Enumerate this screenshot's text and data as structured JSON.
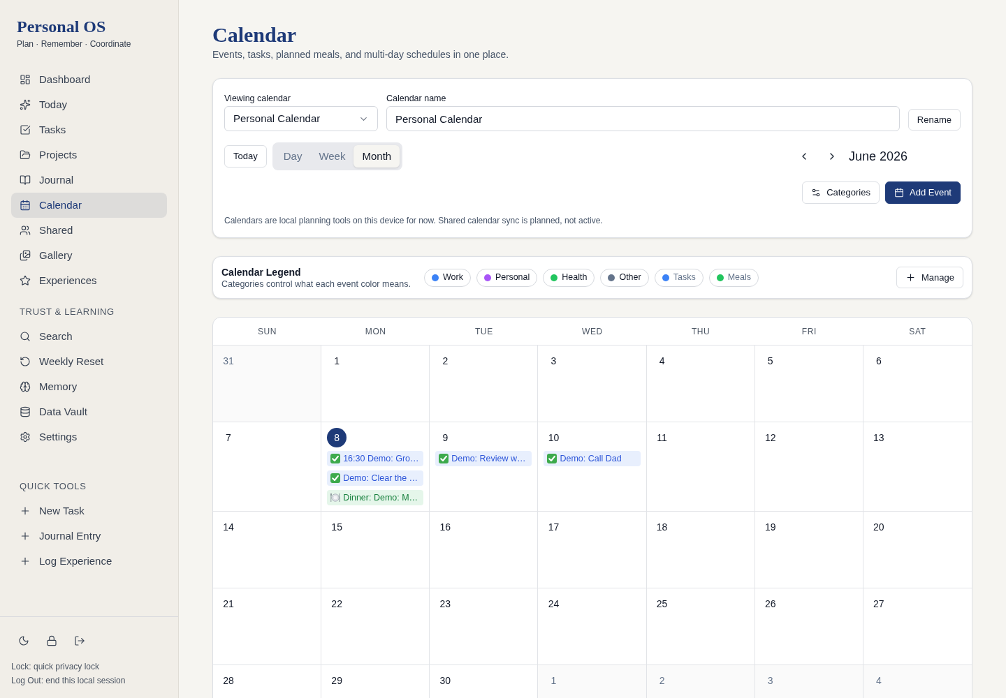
{
  "sidebar": {
    "title": "Personal OS",
    "tagline": "Plan · Remember · Coordinate",
    "nav": [
      {
        "label": "Dashboard",
        "selected": false
      },
      {
        "label": "Today",
        "selected": false
      },
      {
        "label": "Tasks",
        "selected": false
      },
      {
        "label": "Projects",
        "selected": false
      },
      {
        "label": "Journal",
        "selected": false
      },
      {
        "label": "Calendar",
        "selected": true
      },
      {
        "label": "Shared",
        "selected": false
      },
      {
        "label": "Gallery",
        "selected": false
      },
      {
        "label": "Experiences",
        "selected": false
      }
    ],
    "trust_learning": {
      "heading": "TRUST & LEARNING",
      "items": [
        {
          "label": "Search",
          "selected": false
        },
        {
          "label": "Weekly Reset",
          "selected": false
        },
        {
          "label": "Memory",
          "selected": false
        },
        {
          "label": "Data Vault",
          "selected": false
        },
        {
          "label": "Settings",
          "selected": false
        }
      ]
    },
    "quick_tools": {
      "heading": "QUICK TOOLS",
      "items": [
        "New Task",
        "Journal Entry",
        "Log Experience"
      ]
    },
    "footer_notes": [
      "Lock: quick privacy lock",
      "Log Out: end this local session"
    ]
  },
  "header": {
    "title": "Calendar",
    "subtitle": "Events, tasks, planned meals, and multi-day schedules in one place."
  },
  "controls": {
    "viewing_calendar": {
      "label": "Viewing calendar",
      "value": "Personal Calendar"
    },
    "calendar_name": {
      "label": "Calendar name",
      "value": "Personal Calendar"
    },
    "rename_button": "Rename",
    "today_button": "Today",
    "view_tabs": [
      {
        "label": "Day",
        "selected": false
      },
      {
        "label": "Week",
        "selected": false
      },
      {
        "label": "Month",
        "selected": true
      }
    ],
    "period": "June 2026",
    "categories_button": "Categories",
    "add_event_button": "Add Event",
    "note": "Calendars are local planning tools on this device for now. Shared calendar sync is planned, not active."
  },
  "legend": {
    "title": "Calendar Legend",
    "subtitle": "Categories control what each event color means.",
    "categories": [
      {
        "label": "Work",
        "color": "#3b82f6",
        "muted": false
      },
      {
        "label": "Personal",
        "color": "#a855f7",
        "muted": false
      },
      {
        "label": "Health",
        "color": "#22c55e",
        "muted": false
      },
      {
        "label": "Other",
        "color": "#64748b",
        "muted": false
      },
      {
        "label": "Tasks",
        "color": "#3b82f6",
        "muted": true
      },
      {
        "label": "Meals",
        "color": "#22c55e",
        "muted": true
      }
    ],
    "manage_button": "Manage"
  },
  "calendar": {
    "weekdays": [
      "SUN",
      "MON",
      "TUE",
      "WED",
      "THU",
      "FRI",
      "SAT"
    ],
    "weeks": [
      [
        {
          "day": "31",
          "in_month": false,
          "today": false
        },
        {
          "day": "1",
          "in_month": true,
          "today": false
        },
        {
          "day": "2",
          "in_month": true,
          "today": false
        },
        {
          "day": "3",
          "in_month": true,
          "today": false
        },
        {
          "day": "4",
          "in_month": true,
          "today": false
        },
        {
          "day": "5",
          "in_month": true,
          "today": false
        },
        {
          "day": "6",
          "in_month": true,
          "today": false
        }
      ],
      [
        {
          "day": "7",
          "in_month": true,
          "today": false
        },
        {
          "day": "8",
          "in_month": true,
          "today": true,
          "events": [
            {
              "kind": "task",
              "label": "16:30 Demo: Gro…"
            },
            {
              "kind": "task",
              "label": "Demo: Clear the …"
            },
            {
              "kind": "meal",
              "label": "Dinner: Demo: M…"
            }
          ]
        },
        {
          "day": "9",
          "in_month": true,
          "today": false,
          "events": [
            {
              "kind": "task",
              "label": "Demo: Review w…"
            }
          ]
        },
        {
          "day": "10",
          "in_month": true,
          "today": false,
          "events": [
            {
              "kind": "task",
              "label": "Demo: Call Dad"
            }
          ]
        },
        {
          "day": "11",
          "in_month": true,
          "today": false
        },
        {
          "day": "12",
          "in_month": true,
          "today": false
        },
        {
          "day": "13",
          "in_month": true,
          "today": false
        }
      ],
      [
        {
          "day": "14",
          "in_month": true,
          "today": false
        },
        {
          "day": "15",
          "in_month": true,
          "today": false
        },
        {
          "day": "16",
          "in_month": true,
          "today": false
        },
        {
          "day": "17",
          "in_month": true,
          "today": false
        },
        {
          "day": "18",
          "in_month": true,
          "today": false
        },
        {
          "day": "19",
          "in_month": true,
          "today": false
        },
        {
          "day": "20",
          "in_month": true,
          "today": false
        }
      ],
      [
        {
          "day": "21",
          "in_month": true,
          "today": false
        },
        {
          "day": "22",
          "in_month": true,
          "today": false
        },
        {
          "day": "23",
          "in_month": true,
          "today": false
        },
        {
          "day": "24",
          "in_month": true,
          "today": false
        },
        {
          "day": "25",
          "in_month": true,
          "today": false
        },
        {
          "day": "26",
          "in_month": true,
          "today": false
        },
        {
          "day": "27",
          "in_month": true,
          "today": false
        }
      ],
      [
        {
          "day": "28",
          "in_month": true,
          "today": false
        },
        {
          "day": "29",
          "in_month": true,
          "today": false
        },
        {
          "day": "30",
          "in_month": true,
          "today": false
        },
        {
          "day": "1",
          "in_month": false,
          "today": false
        },
        {
          "day": "2",
          "in_month": false,
          "today": false
        },
        {
          "day": "3",
          "in_month": false,
          "today": false
        },
        {
          "day": "4",
          "in_month": false,
          "today": false
        }
      ]
    ]
  }
}
